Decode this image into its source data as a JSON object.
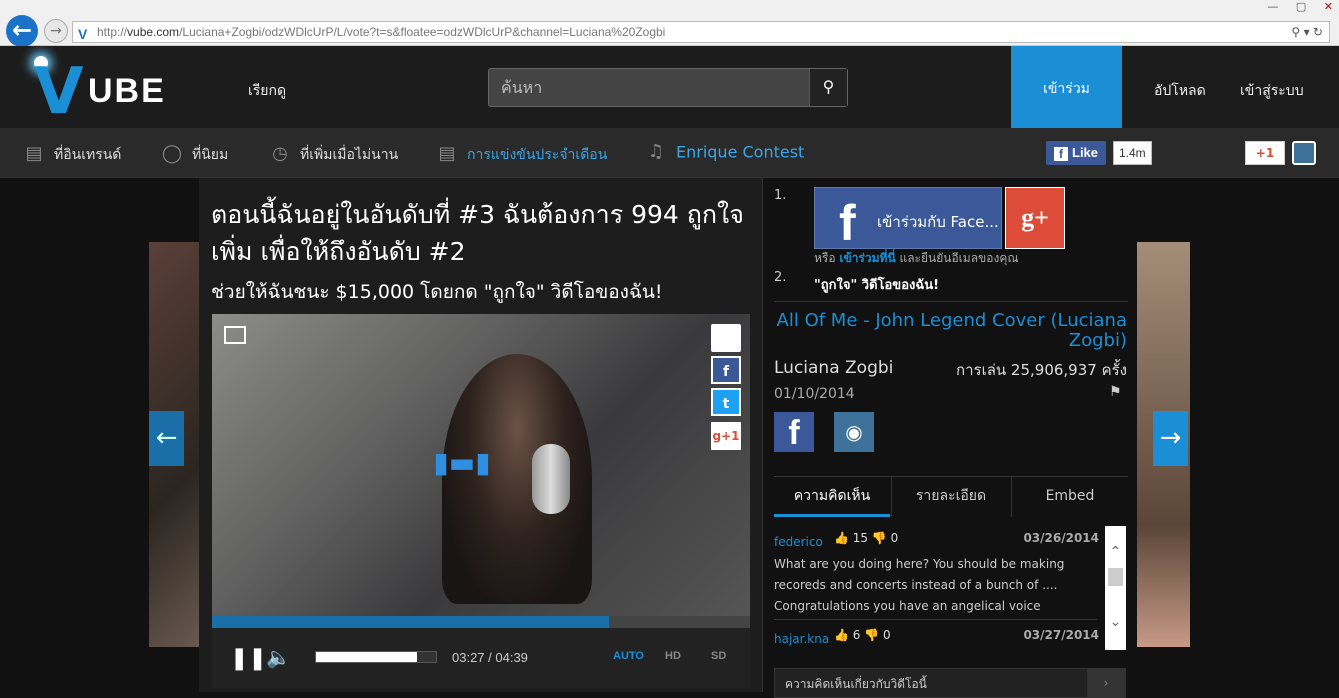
{
  "browser": {
    "url_prefix": "http://",
    "url_domain": "vube.com",
    "url_rest": "/Luciana+Zogbi/odzWDlcUrP/L/vote?t=s&floatee=odzWDlcUrP&channel=Luciana%20Zogbi",
    "back_icon": "arrow-left-icon",
    "forward_icon": "arrow-right-icon"
  },
  "header": {
    "logo_text": "UBE",
    "logo_v": "V",
    "browse_label": "เรียกดู",
    "search_placeholder": "ค้นหา",
    "join_label": "เข้าร่วม",
    "upload_label": "อัปโหลด",
    "login_label": "เข้าสู่ระบบ"
  },
  "subnav": {
    "items": [
      {
        "label": "ที่อินเทรนด์",
        "icon": "trending-chart-icon"
      },
      {
        "label": "ที่นิยม",
        "icon": "chat-bubble-icon"
      },
      {
        "label": "ที่เพิ่มเมื่อไม่นาน",
        "icon": "clock-icon"
      },
      {
        "label": "การแข่งขันประจำเดือน",
        "icon": "money-icon"
      },
      {
        "label": "Enrique Contest",
        "icon": "microphone-icon"
      }
    ],
    "fb_like": "Like",
    "fb_count": "1.4m",
    "gplus": "+1"
  },
  "main": {
    "headline": "ตอนนี้ฉันอยู่ในอันดับที่ #3 ฉันต้องการ 994 ถูกใจเพิ่ม เพื่อให้ถึงอันดับ #2",
    "subhead": "ช่วยให้ฉันชนะ $15,000 โดยกด \"ถูกใจ\" วิดีโอของฉัน!",
    "player": {
      "progress_fraction": 0.738,
      "volume_fraction": 0.84,
      "time": "03:27 / 04:39",
      "quality_auto": "AUTO",
      "quality_hd": "HD",
      "quality_sd": "SD",
      "gplus_label": "g+1"
    }
  },
  "sidebar": {
    "step1": "1.",
    "step2": "2.",
    "fb_join": "เข้าร่วมกับ Face...",
    "gp_join": "g+",
    "or_prefix": "หรือ",
    "or_link": "เข้าร่วมที่นี่",
    "or_suffix": "และยืนยันอีเมลของคุณ",
    "step2_text": "\"ถูกใจ\" วิดีโอของฉัน!",
    "song_title": "All Of Me - John Legend Cover (Luciana Zogbi)",
    "artist": "Luciana Zogbi",
    "plays": "การเล่น 25,906,937 ครั้ง",
    "date": "01/10/2014",
    "tabs": [
      "ความคิดเห็น",
      "รายละเอียด",
      "Embed"
    ],
    "comments": [
      {
        "user": "federico",
        "up": "15",
        "down": "0",
        "date": "03/26/2014",
        "text": "What are you doing here? You should be making recoreds and concerts instead of a bunch of .... Congratulations you have an angelical voice"
      },
      {
        "user": "hajar.kna",
        "up": "6",
        "down": "0",
        "date": "03/27/2014",
        "text": ""
      }
    ],
    "bottom_panel": "ความคิดเห็นเกี่ยวกับวิดีโอนี้"
  },
  "colors": {
    "accent": "#1a8fd6",
    "facebook": "#3b5998",
    "gplus": "#dd4b39"
  }
}
